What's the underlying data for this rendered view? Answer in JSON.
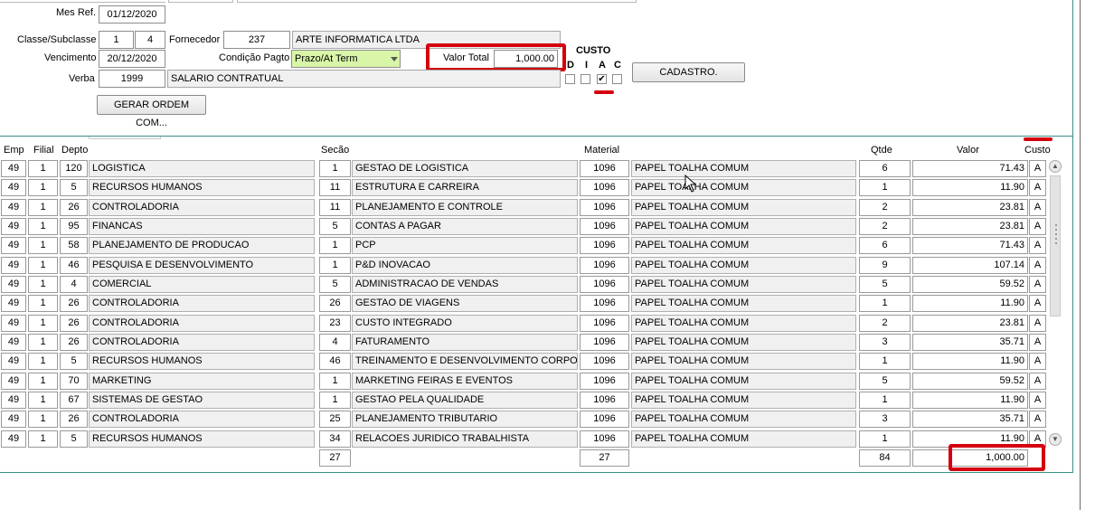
{
  "header": {
    "mes_ref_label": "Mes Ref.",
    "mes_ref_value": "01/12/2020",
    "classe_label": "Classe/Subclasse",
    "classe_value": "1",
    "subclasse_value": "4",
    "fornecedor_label": "Fornecedor",
    "fornecedor_code": "237",
    "fornecedor_name": "ARTE INFORMATICA LTDA",
    "vencimento_label": "Vencimento",
    "vencimento_value": "20/12/2020",
    "condicao_label": "Condição Pagto",
    "condicao_value": "Prazo/At Term",
    "valor_total_label": "Valor Total",
    "valor_total_value": "1,000.00",
    "verba_label": "Verba",
    "verba_code": "1999",
    "verba_name": "SALARIO CONTRATUAL",
    "custo_label": "CUSTO",
    "custo_options": [
      "D",
      "I",
      "A",
      "C"
    ],
    "custo_checked": "A",
    "check_glyph": "✔",
    "cadastro_button": "CADASTRO.",
    "gerar_button": "GERAR ORDEM COM..."
  },
  "grid": {
    "columns": {
      "emp": "Emp",
      "filial": "Filial",
      "depto": "Depto",
      "secao": "Secão",
      "material": "Material",
      "qtde": "Qtde",
      "valor": "Valor",
      "custo": "Custo"
    },
    "rows": [
      {
        "emp": "49",
        "filial": "1",
        "depto": "120",
        "depto_name": "LOGISTICA",
        "secao": "1",
        "secao_name": "GESTAO DE LOGISTICA",
        "material": "1096",
        "material_name": "PAPEL TOALHA COMUM",
        "qtde": "6",
        "valor": "71.43",
        "custo": "A"
      },
      {
        "emp": "49",
        "filial": "1",
        "depto": "5",
        "depto_name": "RECURSOS HUMANOS",
        "secao": "11",
        "secao_name": "ESTRUTURA E CARREIRA",
        "material": "1096",
        "material_name": "PAPEL TOALHA COMUM",
        "qtde": "1",
        "valor": "11.90",
        "custo": "A"
      },
      {
        "emp": "49",
        "filial": "1",
        "depto": "26",
        "depto_name": "CONTROLADORIA",
        "secao": "11",
        "secao_name": "PLANEJAMENTO E CONTROLE",
        "material": "1096",
        "material_name": "PAPEL TOALHA COMUM",
        "qtde": "2",
        "valor": "23.81",
        "custo": "A"
      },
      {
        "emp": "49",
        "filial": "1",
        "depto": "95",
        "depto_name": "FINANCAS",
        "secao": "5",
        "secao_name": "CONTAS A PAGAR",
        "material": "1096",
        "material_name": "PAPEL TOALHA COMUM",
        "qtde": "2",
        "valor": "23.81",
        "custo": "A"
      },
      {
        "emp": "49",
        "filial": "1",
        "depto": "58",
        "depto_name": "PLANEJAMENTO DE PRODUCAO",
        "secao": "1",
        "secao_name": "PCP",
        "material": "1096",
        "material_name": "PAPEL TOALHA COMUM",
        "qtde": "6",
        "valor": "71.43",
        "custo": "A"
      },
      {
        "emp": "49",
        "filial": "1",
        "depto": "46",
        "depto_name": "PESQUISA E DESENVOLVIMENTO",
        "secao": "1",
        "secao_name": "P&D INOVACAO",
        "material": "1096",
        "material_name": "PAPEL TOALHA COMUM",
        "qtde": "9",
        "valor": "107.14",
        "custo": "A"
      },
      {
        "emp": "49",
        "filial": "1",
        "depto": "4",
        "depto_name": "COMERCIAL",
        "secao": "5",
        "secao_name": "ADMINISTRACAO DE VENDAS",
        "material": "1096",
        "material_name": "PAPEL TOALHA COMUM",
        "qtde": "5",
        "valor": "59.52",
        "custo": "A"
      },
      {
        "emp": "49",
        "filial": "1",
        "depto": "26",
        "depto_name": "CONTROLADORIA",
        "secao": "26",
        "secao_name": "GESTAO DE VIAGENS",
        "material": "1096",
        "material_name": "PAPEL TOALHA COMUM",
        "qtde": "1",
        "valor": "11.90",
        "custo": "A"
      },
      {
        "emp": "49",
        "filial": "1",
        "depto": "26",
        "depto_name": "CONTROLADORIA",
        "secao": "23",
        "secao_name": "CUSTO INTEGRADO",
        "material": "1096",
        "material_name": "PAPEL TOALHA COMUM",
        "qtde": "2",
        "valor": "23.81",
        "custo": "A"
      },
      {
        "emp": "49",
        "filial": "1",
        "depto": "26",
        "depto_name": "CONTROLADORIA",
        "secao": "4",
        "secao_name": "FATURAMENTO",
        "material": "1096",
        "material_name": "PAPEL TOALHA COMUM",
        "qtde": "3",
        "valor": "35.71",
        "custo": "A"
      },
      {
        "emp": "49",
        "filial": "1",
        "depto": "5",
        "depto_name": "RECURSOS HUMANOS",
        "secao": "46",
        "secao_name": "TREINAMENTO E DESENVOLVIMENTO CORPORATIVO",
        "material": "1096",
        "material_name": "PAPEL TOALHA COMUM",
        "qtde": "1",
        "valor": "11.90",
        "custo": "A"
      },
      {
        "emp": "49",
        "filial": "1",
        "depto": "70",
        "depto_name": "MARKETING",
        "secao": "1",
        "secao_name": "MARKETING FEIRAS E EVENTOS",
        "material": "1096",
        "material_name": "PAPEL TOALHA COMUM",
        "qtde": "5",
        "valor": "59.52",
        "custo": "A"
      },
      {
        "emp": "49",
        "filial": "1",
        "depto": "67",
        "depto_name": "SISTEMAS DE GESTAO",
        "secao": "1",
        "secao_name": "GESTAO PELA QUALIDADE",
        "material": "1096",
        "material_name": "PAPEL TOALHA COMUM",
        "qtde": "1",
        "valor": "11.90",
        "custo": "A"
      },
      {
        "emp": "49",
        "filial": "1",
        "depto": "26",
        "depto_name": "CONTROLADORIA",
        "secao": "25",
        "secao_name": "PLANEJAMENTO TRIBUTARIO",
        "material": "1096",
        "material_name": "PAPEL TOALHA COMUM",
        "qtde": "3",
        "valor": "35.71",
        "custo": "A"
      },
      {
        "emp": "49",
        "filial": "1",
        "depto": "5",
        "depto_name": "RECURSOS HUMANOS",
        "secao": "34",
        "secao_name": "RELACOES JURIDICO TRABALHISTA",
        "material": "1096",
        "material_name": "PAPEL TOALHA COMUM",
        "qtde": "1",
        "valor": "11.90",
        "custo": "A"
      }
    ],
    "totals": {
      "secao_count": "27",
      "material_count": "27",
      "qtde_total": "84",
      "valor_total": "1,000.00"
    }
  },
  "scrollbar": {
    "up_glyph": "▲",
    "down_glyph": "▼"
  },
  "colors": {
    "highlight_red": "#d4000f",
    "combo_green": "#d8f5a8",
    "panel_border": "#3b8f86"
  }
}
